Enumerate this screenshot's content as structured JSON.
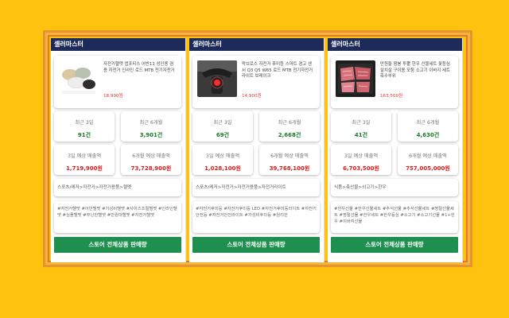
{
  "panels": [
    {
      "header": "셀러마스터",
      "product": {
        "title": "자전거헬멧 앱포티스 어반11 성인용 겸용 자전거 인라인 로드 MTB 전기자전거",
        "price": "18,900원"
      },
      "stats": {
        "recent3_label": "최근 3일",
        "recent3_value": "91건",
        "recent6_label": "최근 6개월",
        "recent6_value": "3,901건",
        "sales3_label": "3일 예상 매출액",
        "sales3_value": "1,719,900원",
        "sales6_label": "6개월 예상 매출액",
        "sales6_value": "73,728,900원"
      },
      "category": "스포츠/레저>자전거>자전거용품>헬멧",
      "tags": "#자전거헬멧 #어반헬멧 #가성비헬멧 #사이즈조절헬멧 #인라인헬멧 #심플헬멧 #무난한헬멧 #만원대헬멧 #자전거헬멧",
      "cta": "스토어 전체상품 판매량"
    },
    {
      "header": "셀러마스터",
      "product": {
        "title": "락브로스 자전거 후미등 스마트 경고 센서 Q3 Q5 W65 로드 MTB 전기자전거 라이트 브레이크",
        "price": "14,900원"
      },
      "stats": {
        "recent3_label": "최근 3일",
        "recent3_value": "69건",
        "recent6_label": "최근 6개월",
        "recent6_value": "2,668건",
        "sales3_label": "3일 예상 매출액",
        "sales3_value": "1,028,100원",
        "sales6_label": "6개월 예상 매출액",
        "sales6_value": "39,768,100원"
      },
      "category": "스포츠/레저>자전거>자전거용품>자전거라이트",
      "tags": "#자전거후미등 #자전거후미등 LED #자전거후미등라이트 #자전거안전등 #자전거안전라이트 #가성비후미등 #원리한",
      "cta": "스토어 전체상품 판매량"
    },
    {
      "header": "셀러마스터",
      "product": {
        "title": "만원들 왕봉 투뿔 한우 선물세트 꽃등심 살치살 구이용 모둠 소고기 이바지 세트 축수부위",
        "price": "163,500원"
      },
      "stats": {
        "recent3_label": "최근 3일",
        "recent3_value": "41건",
        "recent6_label": "최근 6개월",
        "recent6_value": "4,630건",
        "sales3_label": "3일 예상 매출액",
        "sales3_value": "6,703,500원",
        "sales6_label": "6개월 예상 매출액",
        "sales6_value": "757,005,000원"
      },
      "category": "식품>축산물>쇠고기>한우",
      "tags": "#한우선물 #한우선물세트 #추석선물 #추석선물세트 #명절선물세트 #명절선물 #한우세트 #한우등심 #소고기 #소고기선물 #1+한우 #이바지선물",
      "cta": "스토어 전체상품 판매량"
    }
  ],
  "icons": {
    "thumb1": "bike-helmets-image",
    "thumb2": "bike-taillight-image",
    "thumb3": "beef-gift-set-image"
  }
}
